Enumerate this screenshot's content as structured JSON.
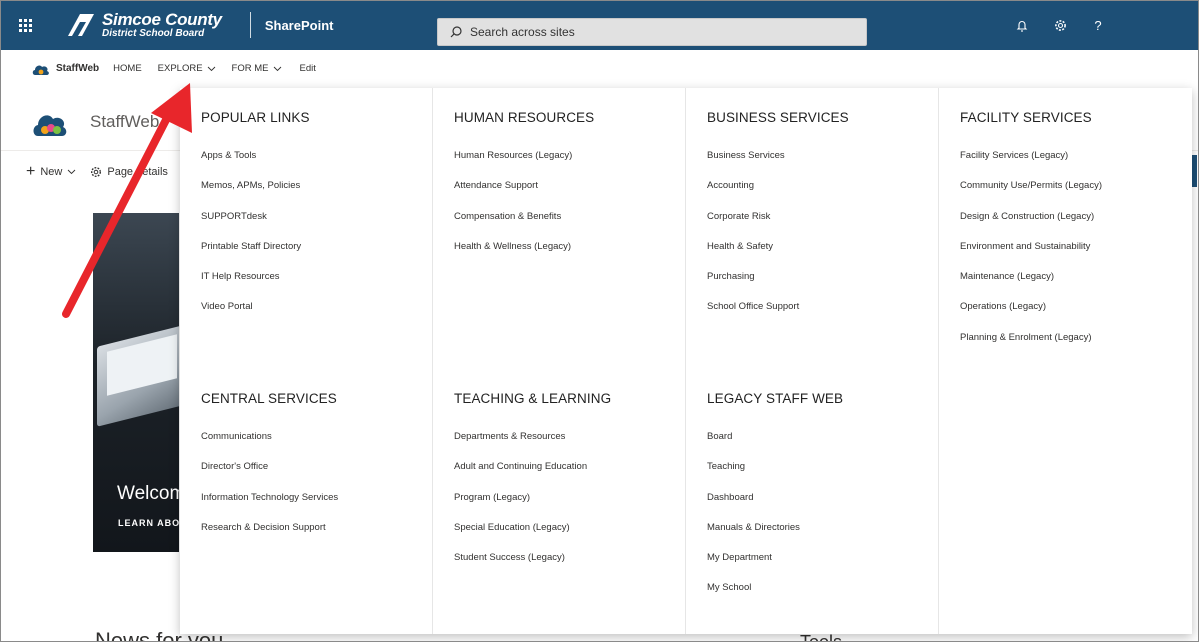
{
  "suite_bar": {
    "brand_line1": "Simcoe County",
    "brand_line2": "District School Board",
    "app_name": "SharePoint",
    "search_placeholder": "Search across sites",
    "icons": [
      "waffle-icon",
      "bell-icon",
      "gear-icon",
      "help-icon"
    ],
    "help_glyph": "?",
    "color": "#1d4f76"
  },
  "hub_nav": {
    "site_name": "StaffWeb",
    "links": [
      {
        "label": "HOME"
      },
      {
        "label": "EXPLORE",
        "expanded": true
      },
      {
        "label": "FOR ME"
      }
    ],
    "edit_label": "Edit"
  },
  "site": {
    "title": "StaffWeb",
    "command_bar": {
      "new_label": "New",
      "page_details_label": "Page details"
    },
    "hero": {
      "welcome_text": "Welcome",
      "learn_text": "LEARN ABOUT"
    },
    "news_title": "News for you",
    "right_section_title": "Tools"
  },
  "mega_menu": {
    "columns": [
      {
        "sections": [
          {
            "heading": "POPULAR LINKS",
            "links": [
              "Apps & Tools",
              "Memos, APMs, Policies",
              "SUPPORTdesk",
              "Printable Staff Directory",
              "IT Help Resources",
              "Video Portal"
            ]
          },
          {
            "heading": "CENTRAL SERVICES",
            "links": [
              "Communications",
              "Director's Office",
              "Information Technology Services",
              "Research & Decision Support"
            ]
          }
        ]
      },
      {
        "sections": [
          {
            "heading": "HUMAN RESOURCES",
            "links": [
              "Human Resources (Legacy)",
              "Attendance Support",
              "Compensation & Benefits",
              "Health & Wellness (Legacy)"
            ]
          },
          {
            "heading": "TEACHING & LEARNING",
            "links": [
              "Departments & Resources",
              "Adult and Continuing Education",
              "Program (Legacy)",
              "Special Education (Legacy)",
              "Student Success (Legacy)"
            ]
          }
        ]
      },
      {
        "sections": [
          {
            "heading": "BUSINESS SERVICES",
            "links": [
              "Business Services",
              "Accounting",
              "Corporate Risk",
              "Health & Safety",
              "Purchasing",
              "School Office Support"
            ]
          },
          {
            "heading": "LEGACY STAFF WEB",
            "links": [
              "Board",
              "Teaching",
              "Dashboard",
              "Manuals & Directories",
              "My Department",
              "My School"
            ]
          }
        ]
      },
      {
        "sections": [
          {
            "heading": "FACILITY SERVICES",
            "links": [
              "Facility Services (Legacy)",
              "Community Use/Permits (Legacy)",
              "Design & Construction (Legacy)",
              "Environment and Sustainability",
              "Maintenance (Legacy)",
              "Operations (Legacy)",
              "Planning & Enrolment (Legacy)"
            ]
          }
        ]
      }
    ]
  },
  "annotation": {
    "arrow_color": "#e8262b"
  }
}
